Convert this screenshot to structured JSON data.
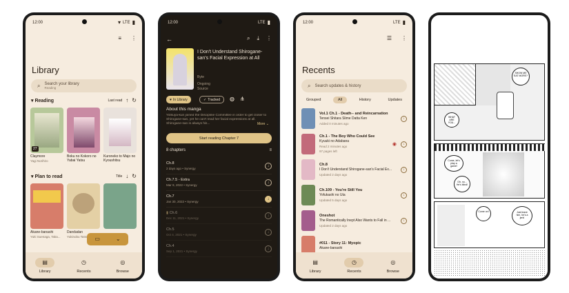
{
  "status": {
    "time": "12:00",
    "network": "LTE"
  },
  "library": {
    "title": "Library",
    "search_placeholder": "Search your library",
    "search_sub": "Reading",
    "sections": [
      {
        "label": "Reading",
        "sort_label": "Last read",
        "items": [
          {
            "title": "Claymore",
            "author": "Yagi Norihiro",
            "badge": "27",
            "color": "#b7c89a"
          },
          {
            "title": "Boku no Kokoro no Yabai Yatsu",
            "author": "",
            "badge": "",
            "color": "#c98aa3"
          },
          {
            "title": "Kuroneko to Majo no Kyoushitsu",
            "author": "",
            "badge": "",
            "color": "#e9e2dc"
          }
        ]
      },
      {
        "label": "Plan to read",
        "sort_label": "Title",
        "items": [
          {
            "title": "Akane-banashi",
            "author": "Yuki Suenaga, Taka...",
            "badge": "",
            "color": "#d77d6a"
          },
          {
            "title": "Dandadan",
            "author": "Yukinobu Tatsu",
            "badge": "",
            "color": "#e4d0a5"
          },
          {
            "title": "",
            "author": "",
            "badge": "",
            "color": "#7aa48a"
          }
        ]
      }
    ],
    "nav": [
      "Library",
      "Recents",
      "Browse"
    ]
  },
  "detail": {
    "title": "I Don't Understand Shirogane-san's Facial Expression at All",
    "author": "Byte",
    "status": "Ongoing",
    "source": "Source",
    "in_library": "In Library",
    "tracked": "Tracked",
    "about_heading": "About this manga",
    "about_text": "Yotsuya-kun joined the Discipline Committee in order to get closer to Shirogane-san, yet he can't read her facial expressions at all. Shirogane-san is always his...",
    "more": "More",
    "start_button": "Start reading Chapter 7",
    "chapters_heading": "8 chapters",
    "chapters": [
      {
        "name": "Ch.8",
        "meta": "2 days ago • Synergy",
        "filled": false
      },
      {
        "name": "Ch.7.5 - Extra",
        "meta": "Mar 9, 2022 • Synergy",
        "filled": false
      },
      {
        "name": "Ch.7",
        "meta": "Jan 30, 2022 • Synergy",
        "filled": true
      },
      {
        "name": "Ch.6",
        "meta": "Dec 11, 2021 • Synergy",
        "filled": false
      },
      {
        "name": "Ch.5",
        "meta": "Oct 4, 2021 • Synergy",
        "filled": false
      },
      {
        "name": "Ch.4",
        "meta": "Sep 1, 2021 • Synergy",
        "filled": false
      }
    ]
  },
  "recents": {
    "title": "Recents",
    "search_placeholder": "Search updates & history",
    "tabs": [
      "Grouped",
      "All",
      "History",
      "Updates"
    ],
    "items": [
      {
        "chapter": "Vol.1 Ch.1 - Death-- and Reincarnation",
        "series": "Tensei Shitara Slime Datta Ken",
        "time": "Added 0 minutes ago",
        "color": "#6f8fb5"
      },
      {
        "chapter": "Ch.1 - The Boy Who Could See",
        "series": "Kyuuki no Adabana",
        "time": "Read 2 minutes ago",
        "time2": "97 pages left",
        "color": "#c26a7a"
      },
      {
        "chapter": "Ch.8",
        "series": "I Don't Understand Shirogane-san's Facial Ex...",
        "time": "Updated 2 days ago",
        "color": "#e3b9c6"
      },
      {
        "chapter": "Ch.109 - You're Still You",
        "series": "Yofukashi no Uta",
        "time": "Updated 5 days ago",
        "color": "#6d8a55"
      },
      {
        "chapter": "Oneshot",
        "series": "The Romantically Inept Also Wants to Fall in ...",
        "time": "Updated 2 days ago",
        "color": "#a45d8c"
      },
      {
        "chapter": "#011 - Story 11: Myopic",
        "series": "Akane-banashi",
        "time": "",
        "color": "#d77d6a"
      }
    ],
    "nav": [
      "Library",
      "Recents",
      "Browse"
    ]
  },
  "reader": {
    "bubbles": [
      "WHAT ARE YOU...",
      "SHOW ME EAT MORE?",
      "Come, let's play a game!",
      "Oh, no... He's blind!",
      "Just leave him, he's a jerk!",
      "Come on!"
    ]
  }
}
